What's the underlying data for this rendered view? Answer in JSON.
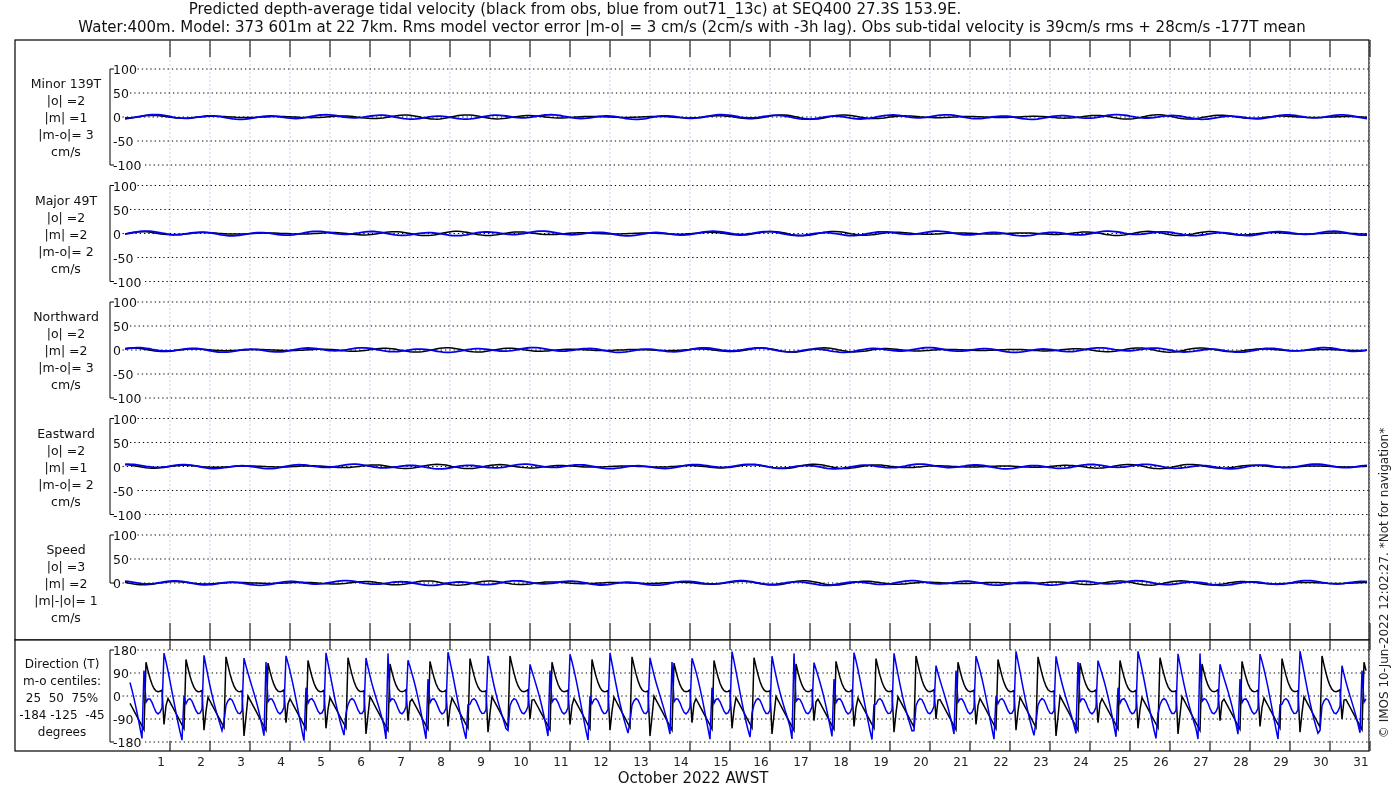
{
  "title": [
    "Predicted depth-average tidal velocity (black from obs, blue from out71_13c) at SEQ400 27.3S 153.9E.",
    "Water:400m. Model: 373 601m at 22 7km. Rms model vector error |m-o| = 3 cm/s (2cm/s with -3h lag). Obs sub-tidal velocity is 39cm/s rms + 28cm/s -177T mean"
  ],
  "panels": [
    {
      "label_lines": [
        "Minor 139T",
        "|o| =2",
        "|m| =1",
        "|m-o|= 3",
        "cm/s"
      ],
      "yticks": [
        "100",
        "50",
        "0",
        "-50",
        "-100"
      ]
    },
    {
      "label_lines": [
        "Major 49T",
        "|o| =2",
        "|m| =2",
        "|m-o|= 2",
        "cm/s"
      ],
      "yticks": [
        "100",
        "50",
        "0",
        "-50",
        "-100"
      ]
    },
    {
      "label_lines": [
        "Northward",
        "|o| =2",
        "|m| =2",
        "|m-o|= 3",
        "cm/s"
      ],
      "yticks": [
        "100",
        "50",
        "0",
        "-50",
        "-100"
      ]
    },
    {
      "label_lines": [
        "Eastward",
        "|o| =2",
        "|m| =1",
        "|m-o|= 2",
        "cm/s"
      ],
      "yticks": [
        "100",
        "50",
        "0",
        "-50",
        "-100"
      ]
    },
    {
      "label_lines": [
        "Speed",
        "|o| =3",
        "|m| =2",
        "|m|-|o|= 1",
        "cm/s"
      ],
      "yticks": [
        "100",
        "50",
        "0"
      ]
    }
  ],
  "direction": {
    "label_lines": [
      "Direction (T)",
      "m-o centiles:",
      "25  50  75%",
      "-184 -125  -45",
      "degrees"
    ],
    "yticks": [
      "180",
      "90",
      "0",
      "-90",
      "-180"
    ]
  },
  "xticks": [
    "1",
    "2",
    "3",
    "4",
    "5",
    "6",
    "7",
    "8",
    "9",
    "10",
    "11",
    "12",
    "13",
    "14",
    "15",
    "16",
    "17",
    "18",
    "19",
    "20",
    "21",
    "22",
    "23",
    "24",
    "25",
    "26",
    "27",
    "28",
    "29",
    "30",
    "31"
  ],
  "xlabel": "October 2022 AWST",
  "credit": "© IMOS 10-Jun-2022 12:02:27. *Not for navigation*"
}
